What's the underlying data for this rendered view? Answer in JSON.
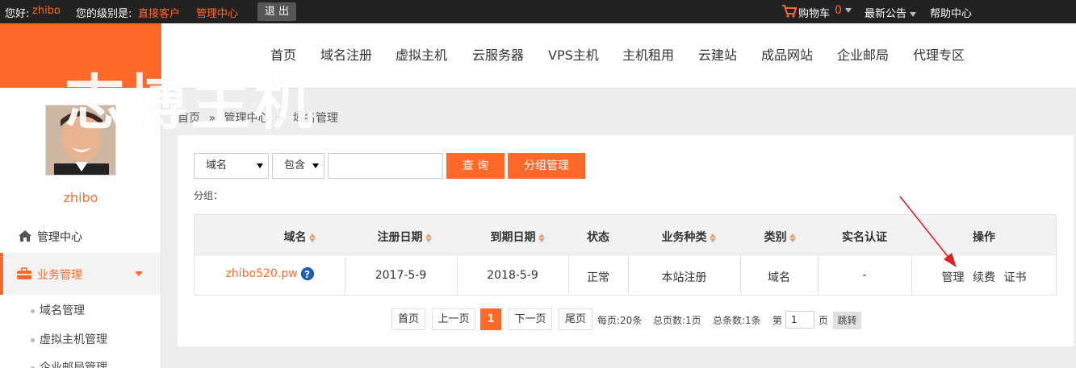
{
  "topbar": {
    "greeting_label": "您好:",
    "username": "zhibo",
    "level_label": "您的级别是:",
    "level_value": "直接客户",
    "admin_link": "管理中心",
    "logout": "退 出",
    "cart_label": "购物车",
    "cart_count": "0",
    "news_label": "最新公告",
    "help_label": "帮助中心"
  },
  "brand_watermark": "志博主机",
  "nav": [
    "首页",
    "域名注册",
    "虚拟主机",
    "云服务器",
    "VPS主机",
    "主机租用",
    "云建站",
    "成品网站",
    "企业邮局",
    "代理专区"
  ],
  "sidebar": {
    "username": "zhibo",
    "home": "管理中心",
    "business": "业务管理",
    "subitems": [
      "域名管理",
      "虚拟主机管理",
      "企业邮局管理"
    ]
  },
  "breadcrumb": [
    "首页",
    "管理中心",
    "域名管理"
  ],
  "breadcrumb_sep": "»",
  "search": {
    "field_select": "域名",
    "match_select": "包含",
    "query_value": "",
    "query_button": "查 询",
    "group_button": "分组管理",
    "group_label": "分组："
  },
  "table": {
    "headers": [
      "域名",
      "注册日期",
      "到期日期",
      "状态",
      "业务种类",
      "类别",
      "实名认证",
      "操作"
    ],
    "rows": [
      {
        "domain": "zhibo520.pw",
        "reg_date": "2017-5-9",
        "exp_date": "2018-5-9",
        "status": "正常",
        "business_type": "本站注册",
        "category": "域名",
        "realname": "-",
        "actions": [
          "管理",
          "续费",
          "证书"
        ]
      }
    ]
  },
  "pagination": {
    "first": "首页",
    "prev": "上一页",
    "current": "1",
    "next": "下一页",
    "last": "尾页",
    "per_page": "每页:20条",
    "total_pages": "总页数:1页",
    "total_items": "总条数:1条",
    "goto_prefix": "第",
    "goto_value": "1",
    "goto_suffix": "页",
    "jump": "跳转"
  },
  "colors": {
    "accent": "#ff6a2a",
    "topbar": "#222222",
    "annotation_arrow": "#e02020"
  }
}
